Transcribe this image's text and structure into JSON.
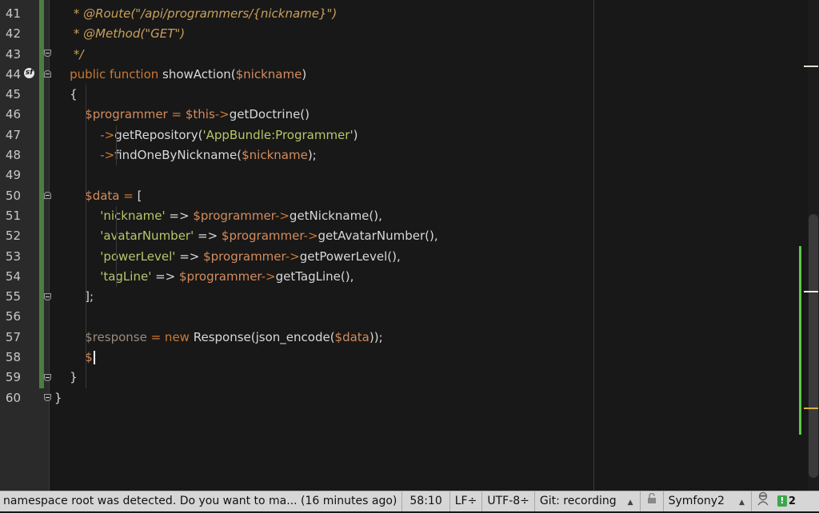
{
  "editor": {
    "lines": [
      {
        "n": "41",
        "tokens": [
          {
            "t": "c",
            "v": "     * @Route(\"/api/programmers/{nickname}\")"
          }
        ]
      },
      {
        "n": "42",
        "tokens": [
          {
            "t": "c",
            "v": "     * @Method(\"GET\")"
          }
        ]
      },
      {
        "n": "43",
        "tokens": [
          {
            "t": "c",
            "v": "     */"
          }
        ]
      },
      {
        "n": "44",
        "tokens": [
          {
            "t": "k",
            "v": "    public function "
          },
          {
            "t": "p",
            "v": "showAction("
          },
          {
            "t": "v",
            "v": "$nickname"
          },
          {
            "t": "p",
            "v": ")"
          }
        ]
      },
      {
        "n": "45",
        "tokens": [
          {
            "t": "p",
            "v": "    {"
          }
        ]
      },
      {
        "n": "46",
        "tokens": [
          {
            "t": "v",
            "v": "        $programmer"
          },
          {
            "t": "k",
            "v": " = "
          },
          {
            "t": "v",
            "v": "$this"
          },
          {
            "t": "k",
            "v": "->"
          },
          {
            "t": "p",
            "v": "getDoctrine()"
          }
        ]
      },
      {
        "n": "47",
        "tokens": [
          {
            "t": "k",
            "v": "            ->"
          },
          {
            "t": "p",
            "v": "getRepository("
          },
          {
            "t": "s",
            "v": "'AppBundle:Programmer'"
          },
          {
            "t": "p",
            "v": ")"
          }
        ]
      },
      {
        "n": "48",
        "tokens": [
          {
            "t": "k",
            "v": "            ->"
          },
          {
            "t": "p",
            "v": "findOneByNickname("
          },
          {
            "t": "v",
            "v": "$nickname"
          },
          {
            "t": "p",
            "v": ");"
          }
        ]
      },
      {
        "n": "49",
        "tokens": []
      },
      {
        "n": "50",
        "tokens": [
          {
            "t": "v",
            "v": "        $data"
          },
          {
            "t": "k",
            "v": " = "
          },
          {
            "t": "p",
            "v": "["
          }
        ]
      },
      {
        "n": "51",
        "tokens": [
          {
            "t": "s",
            "v": "            'nickname'"
          },
          {
            "t": "p",
            "v": " => "
          },
          {
            "t": "v",
            "v": "$programmer"
          },
          {
            "t": "k",
            "v": "->"
          },
          {
            "t": "p",
            "v": "getNickname(),"
          }
        ]
      },
      {
        "n": "52",
        "tokens": [
          {
            "t": "s",
            "v": "            'avatarNumber'"
          },
          {
            "t": "p",
            "v": " => "
          },
          {
            "t": "v",
            "v": "$programmer"
          },
          {
            "t": "k",
            "v": "->"
          },
          {
            "t": "p",
            "v": "getAvatarNumber(),"
          }
        ]
      },
      {
        "n": "53",
        "tokens": [
          {
            "t": "s",
            "v": "            'powerLevel'"
          },
          {
            "t": "p",
            "v": " => "
          },
          {
            "t": "v",
            "v": "$programmer"
          },
          {
            "t": "k",
            "v": "->"
          },
          {
            "t": "p",
            "v": "getPowerLevel(),"
          }
        ]
      },
      {
        "n": "54",
        "tokens": [
          {
            "t": "s",
            "v": "            'tagLine'"
          },
          {
            "t": "p",
            "v": " => "
          },
          {
            "t": "v",
            "v": "$programmer"
          },
          {
            "t": "k",
            "v": "->"
          },
          {
            "t": "p",
            "v": "getTagLine(),"
          }
        ]
      },
      {
        "n": "55",
        "tokens": [
          {
            "t": "p",
            "v": "        ];"
          }
        ]
      },
      {
        "n": "56",
        "tokens": []
      },
      {
        "n": "57",
        "tokens": [
          {
            "t": "g",
            "v": "        $response"
          },
          {
            "t": "k",
            "v": " = new "
          },
          {
            "t": "p",
            "v": "Response(json_encode("
          },
          {
            "t": "v",
            "v": "$data"
          },
          {
            "t": "p",
            "v": "));"
          }
        ]
      },
      {
        "n": "58",
        "tokens": [
          {
            "t": "v",
            "v": "        $"
          }
        ],
        "cursor": true
      },
      {
        "n": "59",
        "tokens": [
          {
            "t": "p",
            "v": "    }"
          }
        ]
      },
      {
        "n": "60",
        "tokens": [
          {
            "t": "p",
            "v": "}"
          }
        ]
      }
    ],
    "gutter_icon": "symfony-icon",
    "fold_markers": [
      "43",
      "44",
      "50",
      "55",
      "59",
      "60"
    ]
  },
  "statusbar": {
    "message": "namespace root was detected. Do you want to ma... (16 minutes ago)",
    "position": "58:10",
    "line_ending": "LF÷",
    "encoding": "UTF-8÷",
    "vcs": "Git: recording",
    "lock_icon": "unlock-icon",
    "framework": "Symfony2",
    "inspector_icon": "hector-icon",
    "notifications": "2"
  },
  "colors": {
    "keyword": "#cc7832",
    "variable": "#d48c5e",
    "string": "#b8c66a",
    "comment": "#c8a05a",
    "change_marker": "#4b7d3f"
  }
}
